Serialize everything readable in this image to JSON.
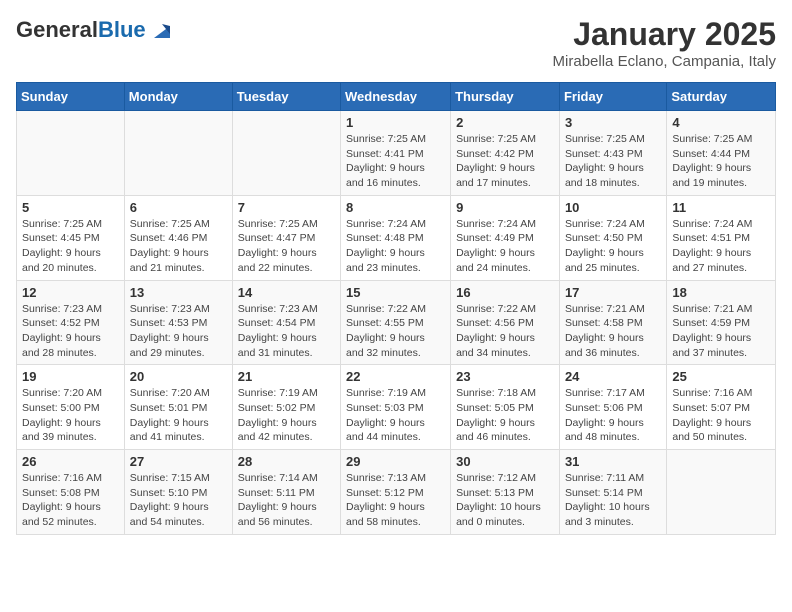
{
  "header": {
    "logo_general": "General",
    "logo_blue": "Blue",
    "month_title": "January 2025",
    "location": "Mirabella Eclano, Campania, Italy"
  },
  "weekdays": [
    "Sunday",
    "Monday",
    "Tuesday",
    "Wednesday",
    "Thursday",
    "Friday",
    "Saturday"
  ],
  "weeks": [
    [
      {
        "day": "",
        "info": ""
      },
      {
        "day": "",
        "info": ""
      },
      {
        "day": "",
        "info": ""
      },
      {
        "day": "1",
        "info": "Sunrise: 7:25 AM\nSunset: 4:41 PM\nDaylight: 9 hours\nand 16 minutes."
      },
      {
        "day": "2",
        "info": "Sunrise: 7:25 AM\nSunset: 4:42 PM\nDaylight: 9 hours\nand 17 minutes."
      },
      {
        "day": "3",
        "info": "Sunrise: 7:25 AM\nSunset: 4:43 PM\nDaylight: 9 hours\nand 18 minutes."
      },
      {
        "day": "4",
        "info": "Sunrise: 7:25 AM\nSunset: 4:44 PM\nDaylight: 9 hours\nand 19 minutes."
      }
    ],
    [
      {
        "day": "5",
        "info": "Sunrise: 7:25 AM\nSunset: 4:45 PM\nDaylight: 9 hours\nand 20 minutes."
      },
      {
        "day": "6",
        "info": "Sunrise: 7:25 AM\nSunset: 4:46 PM\nDaylight: 9 hours\nand 21 minutes."
      },
      {
        "day": "7",
        "info": "Sunrise: 7:25 AM\nSunset: 4:47 PM\nDaylight: 9 hours\nand 22 minutes."
      },
      {
        "day": "8",
        "info": "Sunrise: 7:24 AM\nSunset: 4:48 PM\nDaylight: 9 hours\nand 23 minutes."
      },
      {
        "day": "9",
        "info": "Sunrise: 7:24 AM\nSunset: 4:49 PM\nDaylight: 9 hours\nand 24 minutes."
      },
      {
        "day": "10",
        "info": "Sunrise: 7:24 AM\nSunset: 4:50 PM\nDaylight: 9 hours\nand 25 minutes."
      },
      {
        "day": "11",
        "info": "Sunrise: 7:24 AM\nSunset: 4:51 PM\nDaylight: 9 hours\nand 27 minutes."
      }
    ],
    [
      {
        "day": "12",
        "info": "Sunrise: 7:23 AM\nSunset: 4:52 PM\nDaylight: 9 hours\nand 28 minutes."
      },
      {
        "day": "13",
        "info": "Sunrise: 7:23 AM\nSunset: 4:53 PM\nDaylight: 9 hours\nand 29 minutes."
      },
      {
        "day": "14",
        "info": "Sunrise: 7:23 AM\nSunset: 4:54 PM\nDaylight: 9 hours\nand 31 minutes."
      },
      {
        "day": "15",
        "info": "Sunrise: 7:22 AM\nSunset: 4:55 PM\nDaylight: 9 hours\nand 32 minutes."
      },
      {
        "day": "16",
        "info": "Sunrise: 7:22 AM\nSunset: 4:56 PM\nDaylight: 9 hours\nand 34 minutes."
      },
      {
        "day": "17",
        "info": "Sunrise: 7:21 AM\nSunset: 4:58 PM\nDaylight: 9 hours\nand 36 minutes."
      },
      {
        "day": "18",
        "info": "Sunrise: 7:21 AM\nSunset: 4:59 PM\nDaylight: 9 hours\nand 37 minutes."
      }
    ],
    [
      {
        "day": "19",
        "info": "Sunrise: 7:20 AM\nSunset: 5:00 PM\nDaylight: 9 hours\nand 39 minutes."
      },
      {
        "day": "20",
        "info": "Sunrise: 7:20 AM\nSunset: 5:01 PM\nDaylight: 9 hours\nand 41 minutes."
      },
      {
        "day": "21",
        "info": "Sunrise: 7:19 AM\nSunset: 5:02 PM\nDaylight: 9 hours\nand 42 minutes."
      },
      {
        "day": "22",
        "info": "Sunrise: 7:19 AM\nSunset: 5:03 PM\nDaylight: 9 hours\nand 44 minutes."
      },
      {
        "day": "23",
        "info": "Sunrise: 7:18 AM\nSunset: 5:05 PM\nDaylight: 9 hours\nand 46 minutes."
      },
      {
        "day": "24",
        "info": "Sunrise: 7:17 AM\nSunset: 5:06 PM\nDaylight: 9 hours\nand 48 minutes."
      },
      {
        "day": "25",
        "info": "Sunrise: 7:16 AM\nSunset: 5:07 PM\nDaylight: 9 hours\nand 50 minutes."
      }
    ],
    [
      {
        "day": "26",
        "info": "Sunrise: 7:16 AM\nSunset: 5:08 PM\nDaylight: 9 hours\nand 52 minutes."
      },
      {
        "day": "27",
        "info": "Sunrise: 7:15 AM\nSunset: 5:10 PM\nDaylight: 9 hours\nand 54 minutes."
      },
      {
        "day": "28",
        "info": "Sunrise: 7:14 AM\nSunset: 5:11 PM\nDaylight: 9 hours\nand 56 minutes."
      },
      {
        "day": "29",
        "info": "Sunrise: 7:13 AM\nSunset: 5:12 PM\nDaylight: 9 hours\nand 58 minutes."
      },
      {
        "day": "30",
        "info": "Sunrise: 7:12 AM\nSunset: 5:13 PM\nDaylight: 10 hours\nand 0 minutes."
      },
      {
        "day": "31",
        "info": "Sunrise: 7:11 AM\nSunset: 5:14 PM\nDaylight: 10 hours\nand 3 minutes."
      },
      {
        "day": "",
        "info": ""
      }
    ]
  ]
}
